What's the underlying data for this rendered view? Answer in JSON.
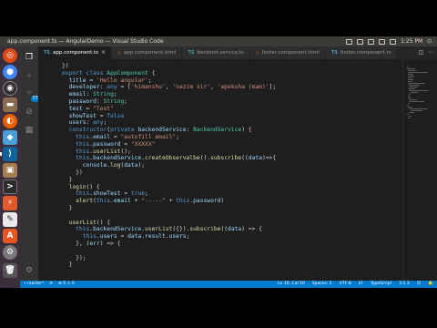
{
  "window": {
    "title": "app.component.ts — AngularDemo — Visual Studio Code",
    "clock": "1:25 PM"
  },
  "launcher": {
    "icons": [
      "ubuntu-icon",
      "chrome-icon",
      "obs-icon",
      "files-icon",
      "firefox-icon",
      "app-icon",
      "vscode-icon",
      "archive-icon",
      "terminal-icon",
      "lightning-icon",
      "gedit-icon",
      "software-icon",
      "settings-icon",
      "trash-icon"
    ]
  },
  "activity_bar": {
    "icons": [
      "explorer-icon",
      "search-icon",
      "git-icon",
      "debug-icon",
      "extensions-icon"
    ],
    "git_badge": "77",
    "bottom_icon": "manage-icon"
  },
  "tabs": [
    {
      "label": "app.component.ts",
      "type": "ts",
      "active": true
    },
    {
      "label": "app.component.html",
      "type": "html",
      "active": false
    },
    {
      "label": "backend.service.ts",
      "type": "ts",
      "active": false
    },
    {
      "label": "footer.component.html",
      "type": "html",
      "active": false
    },
    {
      "label": "footer.component.ts",
      "type": "ts",
      "active": false
    }
  ],
  "code_lines": [
    [
      {
        "t": "})",
        "c": "pun"
      }
    ],
    [
      {
        "t": "export ",
        "c": "kw"
      },
      {
        "t": "class ",
        "c": "kw"
      },
      {
        "t": "AppComponent",
        "c": "cls"
      },
      {
        "t": " {",
        "c": "pun"
      }
    ],
    [
      {
        "t": "  title",
        "c": "prop"
      },
      {
        "t": " = ",
        "c": "pun"
      },
      {
        "t": "'Hello angular'",
        "c": "str"
      },
      {
        "t": ";",
        "c": "pun"
      }
    ],
    [
      {
        "t": "  developer",
        "c": "prop"
      },
      {
        "t": ": ",
        "c": "pun"
      },
      {
        "t": "any",
        "c": "kw"
      },
      {
        "t": " = [",
        "c": "pun"
      },
      {
        "t": "'himanshu'",
        "c": "str"
      },
      {
        "t": ", ",
        "c": "pun"
      },
      {
        "t": "'nazim sir'",
        "c": "str"
      },
      {
        "t": ", ",
        "c": "pun"
      },
      {
        "t": "'apeksha (mam)'",
        "c": "str"
      },
      {
        "t": "];",
        "c": "pun"
      }
    ],
    [
      {
        "t": "  email",
        "c": "prop"
      },
      {
        "t": ": ",
        "c": "pun"
      },
      {
        "t": "String",
        "c": "cls"
      },
      {
        "t": ";",
        "c": "pun"
      }
    ],
    [
      {
        "t": "  password",
        "c": "prop"
      },
      {
        "t": ": ",
        "c": "pun"
      },
      {
        "t": "String",
        "c": "cls"
      },
      {
        "t": ";",
        "c": "pun"
      }
    ],
    [
      {
        "t": "  test",
        "c": "prop"
      },
      {
        "t": " = ",
        "c": "pun"
      },
      {
        "t": "\"Test\"",
        "c": "str"
      }
    ],
    [
      {
        "t": "  showTest",
        "c": "prop"
      },
      {
        "t": " = ",
        "c": "pun"
      },
      {
        "t": "false",
        "c": "kw"
      }
    ],
    [
      {
        "t": "  users",
        "c": "prop"
      },
      {
        "t": ": ",
        "c": "pun"
      },
      {
        "t": "any",
        "c": "kw"
      },
      {
        "t": ";",
        "c": "pun"
      }
    ],
    [
      {
        "t": "  constructor",
        "c": "kw"
      },
      {
        "t": "(",
        "c": "pun"
      },
      {
        "t": "private ",
        "c": "kw"
      },
      {
        "t": "backendService",
        "c": "prop"
      },
      {
        "t": ": ",
        "c": "pun"
      },
      {
        "t": "BackendService",
        "c": "cls"
      },
      {
        "t": ") {",
        "c": "pun"
      }
    ],
    [
      {
        "t": "    this",
        "c": "kw"
      },
      {
        "t": ".",
        "c": "pun"
      },
      {
        "t": "email",
        "c": "prop"
      },
      {
        "t": " = ",
        "c": "pun"
      },
      {
        "t": "\"autofill email\"",
        "c": "str"
      },
      {
        "t": ";",
        "c": "pun"
      }
    ],
    [
      {
        "t": "    this",
        "c": "kw"
      },
      {
        "t": ".",
        "c": "pun"
      },
      {
        "t": "password",
        "c": "prop"
      },
      {
        "t": " = ",
        "c": "pun"
      },
      {
        "t": "\"XXXXX\"",
        "c": "str"
      }
    ],
    [
      {
        "t": "    this",
        "c": "kw"
      },
      {
        "t": ".",
        "c": "pun"
      },
      {
        "t": "userList",
        "c": "fn"
      },
      {
        "t": "();",
        "c": "pun"
      }
    ],
    [
      {
        "t": "    this",
        "c": "kw"
      },
      {
        "t": ".",
        "c": "pun"
      },
      {
        "t": "backendService",
        "c": "prop"
      },
      {
        "t": ".",
        "c": "pun"
      },
      {
        "t": "createObservalbe",
        "c": "fn"
      },
      {
        "t": "().",
        "c": "pun"
      },
      {
        "t": "subscribe",
        "c": "fn"
      },
      {
        "t": "((",
        "c": "pun"
      },
      {
        "t": "data",
        "c": "prop"
      },
      {
        "t": ")=>{",
        "c": "pun"
      }
    ],
    [
      {
        "t": "      console",
        "c": "prop"
      },
      {
        "t": ".",
        "c": "pun"
      },
      {
        "t": "log",
        "c": "fn"
      },
      {
        "t": "(",
        "c": "pun"
      },
      {
        "t": "data",
        "c": "prop"
      },
      {
        "t": ");",
        "c": "pun"
      }
    ],
    [
      {
        "t": "    })",
        "c": "pun"
      }
    ],
    [
      {
        "t": "  }",
        "c": "pun"
      }
    ],
    [
      {
        "t": "  login",
        "c": "fn"
      },
      {
        "t": "() {",
        "c": "pun"
      }
    ],
    [
      {
        "t": "    this",
        "c": "kw"
      },
      {
        "t": ".",
        "c": "pun"
      },
      {
        "t": "showTest",
        "c": "prop"
      },
      {
        "t": " = ",
        "c": "pun"
      },
      {
        "t": "true",
        "c": "kw"
      },
      {
        "t": ";",
        "c": "pun"
      }
    ],
    [
      {
        "t": "    alert",
        "c": "fn"
      },
      {
        "t": "(",
        "c": "pun"
      },
      {
        "t": "this",
        "c": "kw"
      },
      {
        "t": ".",
        "c": "pun"
      },
      {
        "t": "email",
        "c": "prop"
      },
      {
        "t": " + ",
        "c": "pun"
      },
      {
        "t": "\"-----\"",
        "c": "str"
      },
      {
        "t": " + ",
        "c": "pun"
      },
      {
        "t": "this",
        "c": "kw"
      },
      {
        "t": ".",
        "c": "pun"
      },
      {
        "t": "password",
        "c": "prop"
      },
      {
        "t": ")",
        "c": "pun"
      }
    ],
    [
      {
        "t": "  }",
        "c": "pun"
      }
    ],
    [
      {
        "t": "",
        "c": "pun"
      }
    ],
    [
      {
        "t": "  userList",
        "c": "fn"
      },
      {
        "t": "() {",
        "c": "pun"
      }
    ],
    [
      {
        "t": "    this",
        "c": "kw"
      },
      {
        "t": ".",
        "c": "pun"
      },
      {
        "t": "backendService",
        "c": "prop"
      },
      {
        "t": ".",
        "c": "pun"
      },
      {
        "t": "userList",
        "c": "fn"
      },
      {
        "t": "({}).",
        "c": "pun"
      },
      {
        "t": "subscribe",
        "c": "fn"
      },
      {
        "t": "((",
        "c": "pun"
      },
      {
        "t": "data",
        "c": "prop"
      },
      {
        "t": ") => {",
        "c": "pun"
      }
    ],
    [
      {
        "t": "      this",
        "c": "kw"
      },
      {
        "t": ".",
        "c": "pun"
      },
      {
        "t": "users",
        "c": "prop"
      },
      {
        "t": " = ",
        "c": "pun"
      },
      {
        "t": "data",
        "c": "prop"
      },
      {
        "t": ".",
        "c": "pun"
      },
      {
        "t": "result",
        "c": "prop"
      },
      {
        "t": ".",
        "c": "pun"
      },
      {
        "t": "users",
        "c": "prop"
      },
      {
        "t": ";",
        "c": "pun"
      }
    ],
    [
      {
        "t": "    }, (",
        "c": "pun"
      },
      {
        "t": "err",
        "c": "prop"
      },
      {
        "t": ") => {",
        "c": "pun"
      }
    ],
    [
      {
        "t": "",
        "c": "pun"
      }
    ],
    [
      {
        "t": "    });",
        "c": "pun"
      }
    ],
    [
      {
        "t": "  }",
        "c": "pun"
      }
    ]
  ],
  "line_numbers": [
    "9",
    "10",
    "11",
    "12",
    "13",
    "14",
    "15",
    "16",
    "17",
    "18",
    "19",
    "20",
    "21",
    "22",
    "23",
    "24",
    "25",
    "26",
    "27",
    "28",
    "29",
    "30",
    "31",
    "32",
    "33",
    "34",
    "35",
    "36",
    "37"
  ],
  "status_bar": {
    "branch": "master*",
    "errors": "0",
    "warnings": "0",
    "cursor": "Ln 10, Col 10",
    "spaces": "Spaces: 2",
    "encoding": "UTF-8",
    "eol": "LF",
    "language": "TypeScript",
    "version": "3.1.3"
  },
  "colors": {
    "accent": "#007acc",
    "editor_bg": "#1e1e1e",
    "launcher_bg": "#3a2f3a"
  }
}
